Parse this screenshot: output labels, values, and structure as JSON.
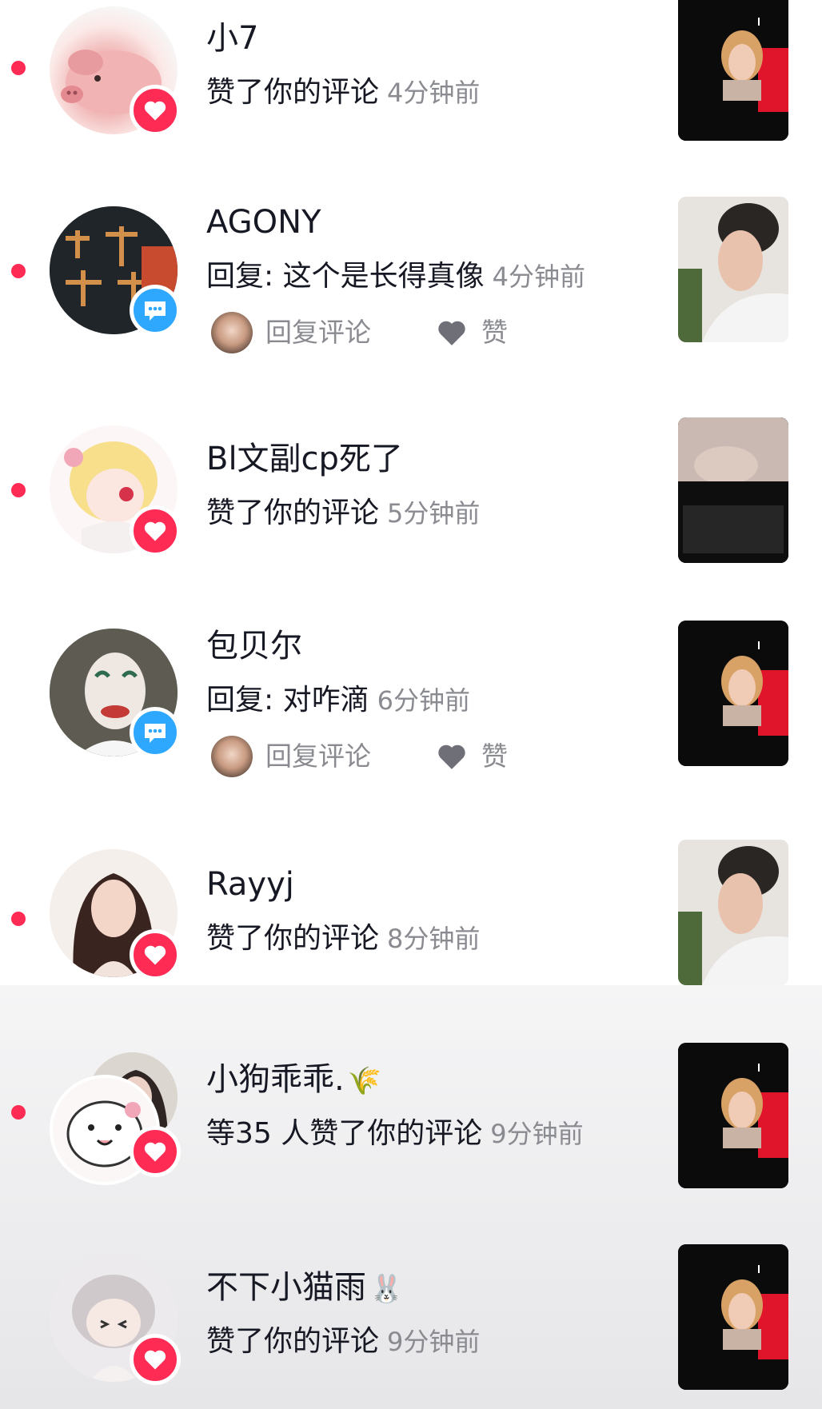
{
  "notifications": [
    {
      "name": "小7",
      "action": "赞了你的评论",
      "time": "4分钟前"
    },
    {
      "name": "AGONY",
      "action": "回复: 这个是长得真像",
      "time": "4分钟前",
      "reply_label": "回复评论",
      "like_label": "赞"
    },
    {
      "name": "Bl文副cp死了",
      "action": "赞了你的评论",
      "time": "5分钟前"
    },
    {
      "name": "包贝尔",
      "action": "回复: 对咋滴",
      "time": "6分钟前",
      "reply_label": "回复评论",
      "like_label": "赞"
    },
    {
      "name": "Rayyj",
      "action": "赞了你的评论",
      "time": "8分钟前"
    },
    {
      "name": "小狗乖乖.",
      "name_emoji": "🌾",
      "action": "等35 人赞了你的评论",
      "time": "9分钟前"
    },
    {
      "name": "不下小猫雨",
      "name_emoji": "🐰",
      "action": "赞了你的评论",
      "time": "9分钟前"
    }
  ],
  "colors": {
    "unread_dot": "#fe2c55",
    "like_badge": "#fe2c55",
    "reply_badge": "#2ea7ff",
    "secondary_text": "#8a8b91"
  },
  "icons": {
    "like_badge": "heart-icon",
    "reply_badge": "chat-bubble-icon",
    "like_action": "heart-outline-icon"
  }
}
